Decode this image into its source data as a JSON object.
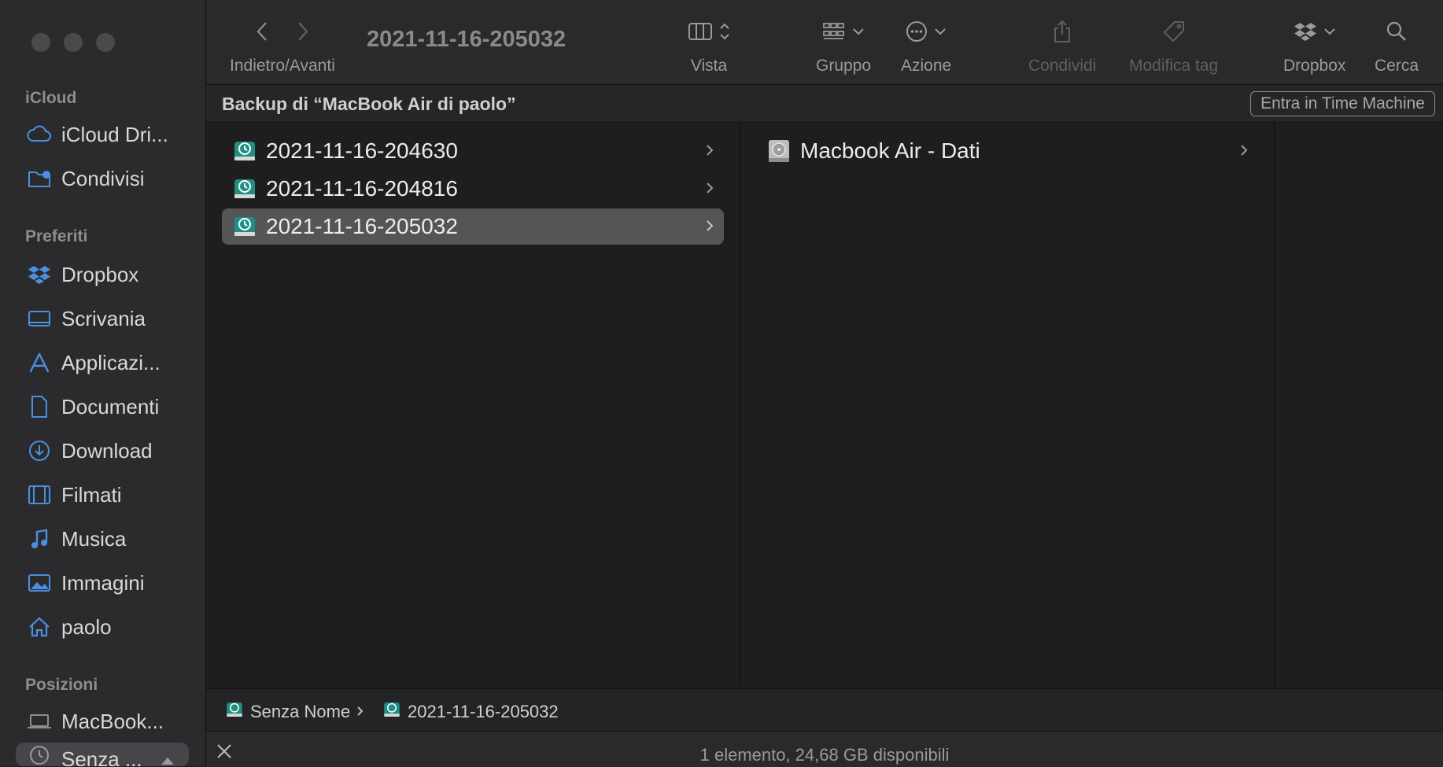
{
  "window": {
    "title": "2021-11-16-205032"
  },
  "toolbar": {
    "nav_label": "Indietro/Avanti",
    "view_label": "Vista",
    "group_label": "Gruppo",
    "action_label": "Azione",
    "share_label": "Condividi",
    "tag_label": "Modifica tag",
    "dropbox_label": "Dropbox",
    "search_label": "Cerca"
  },
  "sidebar": {
    "sections": {
      "icloud": "iCloud",
      "favorites": "Preferiti",
      "locations": "Posizioni"
    },
    "icloud_items": [
      {
        "label": "iCloud Dri...",
        "icon": "cloud-icon"
      },
      {
        "label": "Condivisi",
        "icon": "shared-folder-icon"
      }
    ],
    "favorites": [
      {
        "label": "Dropbox",
        "icon": "dropbox-icon"
      },
      {
        "label": "Scrivania",
        "icon": "desktop-icon"
      },
      {
        "label": "Applicazi...",
        "icon": "applications-icon"
      },
      {
        "label": "Documenti",
        "icon": "document-icon"
      },
      {
        "label": "Download",
        "icon": "download-icon"
      },
      {
        "label": "Filmati",
        "icon": "film-icon"
      },
      {
        "label": "Musica",
        "icon": "music-icon"
      },
      {
        "label": "Immagini",
        "icon": "photo-icon"
      },
      {
        "label": "paolo",
        "icon": "home-icon"
      }
    ],
    "locations": [
      {
        "label": "MacBook...",
        "icon": "laptop-icon"
      },
      {
        "label": "Senza ...",
        "icon": "time-machine-icon",
        "selected": true
      }
    ]
  },
  "header": {
    "title": "Backup di “MacBook Air di paolo”",
    "time_machine_button": "Entra in Time Machine"
  },
  "column1": {
    "items": [
      {
        "label": "2021-11-16-204630",
        "selected": false
      },
      {
        "label": "2021-11-16-204816",
        "selected": false
      },
      {
        "label": "2021-11-16-205032",
        "selected": true
      }
    ]
  },
  "column2": {
    "items": [
      {
        "label": "Macbook Air - Dati",
        "icon": "hard-drive-icon"
      }
    ]
  },
  "pathbar": {
    "items": [
      "Senza Nome",
      "2021-11-16-205032"
    ]
  },
  "status": {
    "text": "1 elemento, 24,68 GB disponibili"
  },
  "colors": {
    "accent_teal": "#2a9d8f",
    "sidebar_icon": "#4b8fe0"
  }
}
